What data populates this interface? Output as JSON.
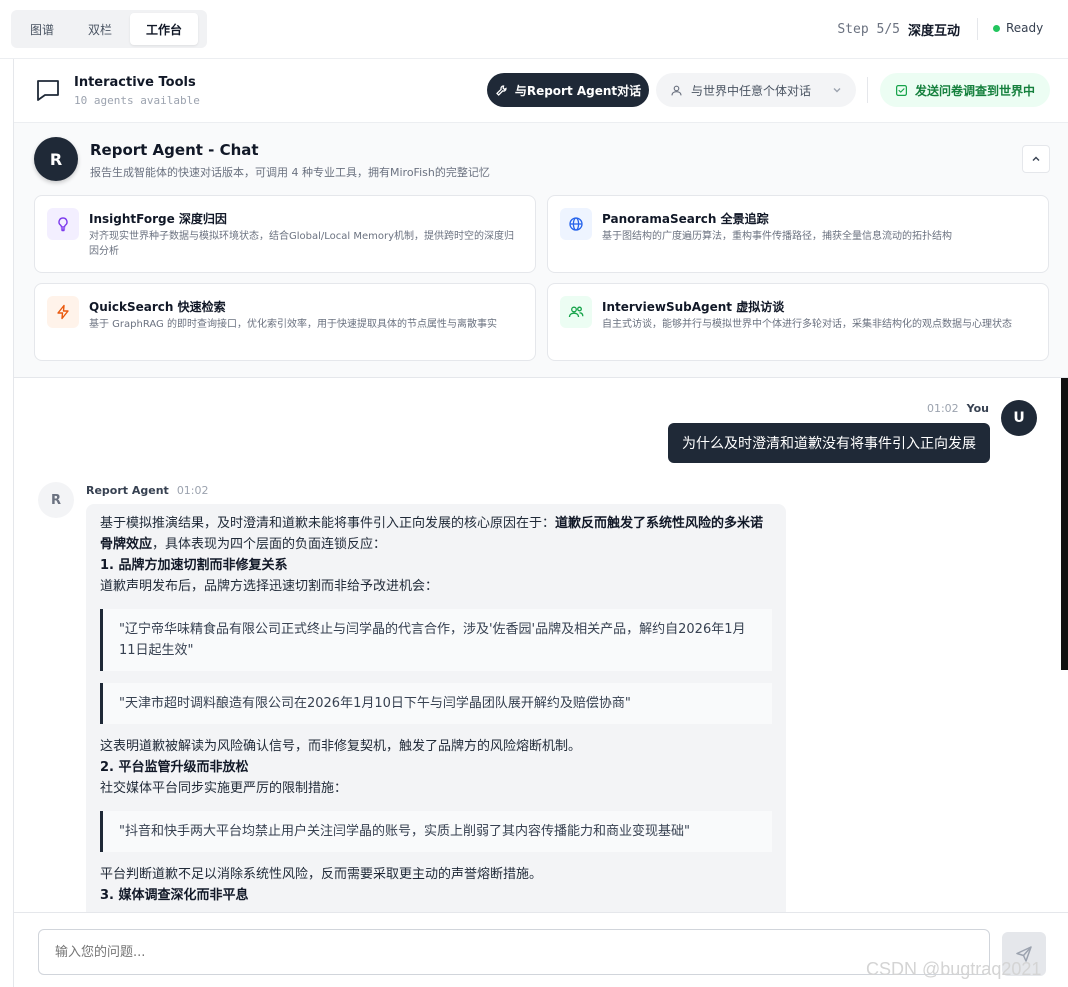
{
  "view_tabs": [
    "图谱",
    "双栏",
    "工作台"
  ],
  "active_tab_index": 2,
  "step": {
    "label": "Step 5/5",
    "name": "深度互动"
  },
  "status": {
    "text": "Ready",
    "color": "#22c55e"
  },
  "tools_header": {
    "title": "Interactive Tools",
    "subtitle": "10 agents available",
    "report_agent_btn": "与Report Agent对话",
    "world_select": "与世界中任意个体对话",
    "survey_btn": "发送问卷调查到世界中"
  },
  "agent": {
    "avatar": "R",
    "name": "Report Agent - Chat",
    "desc": "报告生成智能体的快速对话版本，可调用 4 种专业工具，拥有MiroFish的完整记忆"
  },
  "tools": [
    {
      "icon": "lightbulb-icon",
      "name": "InsightForge 深度归因",
      "desc": "对齐现实世界种子数据与模拟环境状态，结合Global/Local Memory机制，提供跨时空的深度归因分析",
      "color": "#7c3aed",
      "bg": "#f3efff"
    },
    {
      "icon": "globe-icon",
      "name": "PanoramaSearch 全景追踪",
      "desc": "基于图结构的广度遍历算法，重构事件传播路径，捕获全量信息流动的拓扑结构",
      "color": "#2563eb",
      "bg": "#eef4ff"
    },
    {
      "icon": "lightning-icon",
      "name": "QuickSearch 快速检索",
      "desc": "基于 GraphRAG 的即时查询接口，优化索引效率，用于快速提取具体的节点属性与离散事实",
      "color": "#ea580c",
      "bg": "#fff3ea"
    },
    {
      "icon": "users-icon",
      "name": "InterviewSubAgent 虚拟访谈",
      "desc": "自主式访谈，能够并行与模拟世界中个体进行多轮对话，采集非结构化的观点数据与心理状态",
      "color": "#16a34a",
      "bg": "#ecfdf3"
    }
  ],
  "chat": {
    "user": {
      "avatar": "U",
      "name": "You",
      "time": "01:02",
      "text": "为什么及时澄清和道歉没有将事件引入正向发展"
    },
    "agent": {
      "avatar": "R",
      "name": "Report Agent",
      "time": "01:02",
      "intro": "基于模拟推演结果，及时澄清和道歉未能将事件引入正向发展的核心原因在于：",
      "intro_bold": "道歉反而触发了系统性风险的多米诺骨牌效应",
      "intro_tail": "，具体表现为四个层面的负面连锁反应：",
      "h1": "1. 品牌方加速切割而非修复关系",
      "p1": "道歉声明发布后，品牌方选择迅速切割而非给予改进机会：",
      "q1": "\"辽宁帝华味精食品有限公司正式终止与闫学晶的代言合作，涉及'佐香园'品牌及相关产品，解约自2026年1月11日起生效\"",
      "q2": "\"天津市超时调料酿造有限公司在2026年1月10日下午与闫学晶团队展开解约及赔偿协商\"",
      "p2": "这表明道歉被解读为风险确认信号，而非修复契机，触发了品牌方的风险熔断机制。",
      "h2": "2. 平台监管升级而非放松",
      "p3": "社交媒体平台同步实施更严厉的限制措施：",
      "q3": "\"抖音和快手两大平台均禁止用户关注闫学晶的账号，实质上削弱了其内容传播能力和商业变现基础\"",
      "p4": "平台判断道歉不足以消除系统性风险，反而需要采取更主动的声誉熔断措施。",
      "h3": "3. 媒体调查深化而非平息"
    }
  },
  "input": {
    "placeholder": "输入您的问题..."
  },
  "watermark": "CSDN @bugtraq2021"
}
